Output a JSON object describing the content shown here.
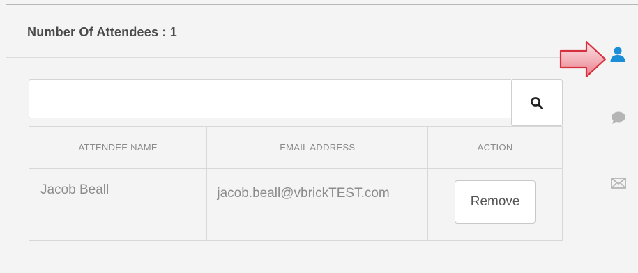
{
  "header": {
    "title": "Number Of Attendees : 1"
  },
  "search": {
    "value": "",
    "placeholder": "",
    "icon": "search-icon"
  },
  "table": {
    "columns": [
      "ATTENDEE NAME",
      "EMAIL ADDRESS",
      "ACTION"
    ],
    "rows": [
      {
        "name": "Jacob Beall",
        "email": "jacob.beall@vbrickTEST.com",
        "action_label": "Remove"
      }
    ]
  },
  "side_rail": {
    "items": [
      {
        "icon": "user-icon",
        "active": true,
        "color": "#1a8fd8"
      },
      {
        "icon": "chat-bubble-icon",
        "active": false,
        "color": "#b5b5b5"
      },
      {
        "icon": "envelope-icon",
        "active": false,
        "color": "#b5b5b5"
      }
    ]
  },
  "colors": {
    "accent": "#1a8fd8",
    "callout_arrow": "#e84a5a"
  }
}
